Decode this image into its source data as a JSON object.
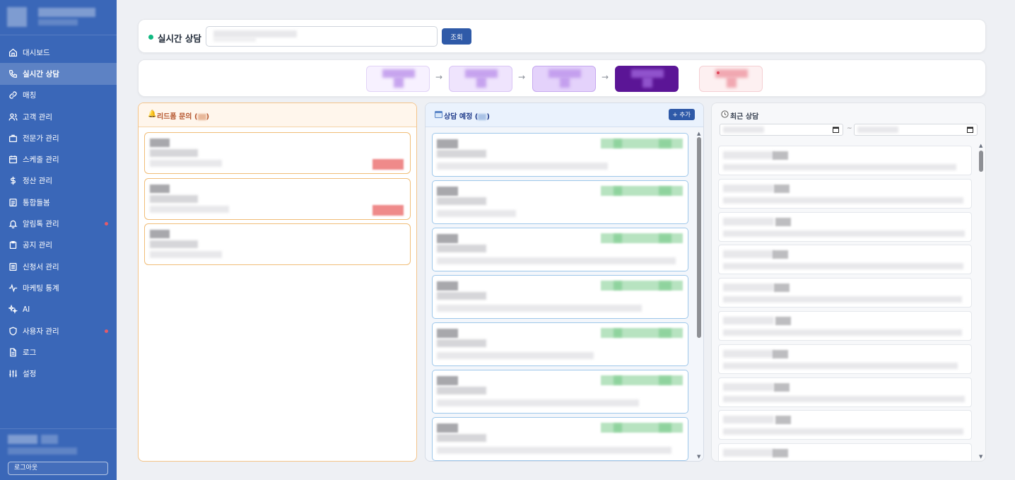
{
  "sidebar": {
    "items": [
      {
        "label": "대시보드",
        "icon": "home-icon",
        "active": false,
        "alert": false
      },
      {
        "label": "실시간 상담",
        "icon": "phone-icon",
        "active": true,
        "alert": false
      },
      {
        "label": "매칭",
        "icon": "link-icon",
        "active": false,
        "alert": false
      },
      {
        "label": "고객 관리",
        "icon": "users-icon",
        "active": false,
        "alert": false
      },
      {
        "label": "전문가 관리",
        "icon": "briefcase-icon",
        "active": false,
        "alert": false
      },
      {
        "label": "스케줄 관리",
        "icon": "calendar-icon",
        "active": false,
        "alert": false
      },
      {
        "label": "정산 관리",
        "icon": "dollar-icon",
        "active": false,
        "alert": false
      },
      {
        "label": "통합들봄",
        "icon": "document-icon",
        "active": false,
        "alert": false
      },
      {
        "label": "알림톡 관리",
        "icon": "bell-icon",
        "active": false,
        "alert": true
      },
      {
        "label": "공지 관리",
        "icon": "clipboard-icon",
        "active": false,
        "alert": false
      },
      {
        "label": "신청서 관리",
        "icon": "form-icon",
        "active": false,
        "alert": false
      },
      {
        "label": "마케팅 통계",
        "icon": "activity-icon",
        "active": false,
        "alert": false
      },
      {
        "label": "AI",
        "icon": "sparkle-icon",
        "active": false,
        "alert": false
      },
      {
        "label": "사용자 관리",
        "icon": "shield-icon",
        "active": false,
        "alert": true
      },
      {
        "label": "로그",
        "icon": "file-icon",
        "active": false,
        "alert": false
      },
      {
        "label": "설정",
        "icon": "sliders-icon",
        "active": false,
        "alert": false
      }
    ],
    "logout_label": "로그아웃"
  },
  "topbar": {
    "title": "실시간 상담",
    "query_label": "조회",
    "status_color": "#10b981"
  },
  "pipeline": {
    "stages": [
      {
        "bg": "#f7f1ff",
        "border": "#e2d3f7"
      },
      {
        "bg": "#efe4fd",
        "border": "#d9c5f5"
      },
      {
        "bg": "#e4d2fb",
        "border": "#c6a9ef"
      },
      {
        "bg": "#5b1596",
        "border": "#5b1596"
      },
      {
        "bg": "#fdf0f1",
        "border": "#f5cfd3"
      }
    ]
  },
  "columns": {
    "lead": {
      "title": "리드폼 문의 (",
      "title_close": ")",
      "icon": "bell-icon",
      "accent": "#f0bd78"
    },
    "scheduled": {
      "title": "상담 예정 (",
      "title_close": ")",
      "icon": "calendar-icon",
      "add_label": "+ 추가",
      "accent": "#9ec7ea"
    },
    "recent": {
      "title": "최근 상담",
      "icon": "clock-icon",
      "date_separator": "~"
    }
  }
}
